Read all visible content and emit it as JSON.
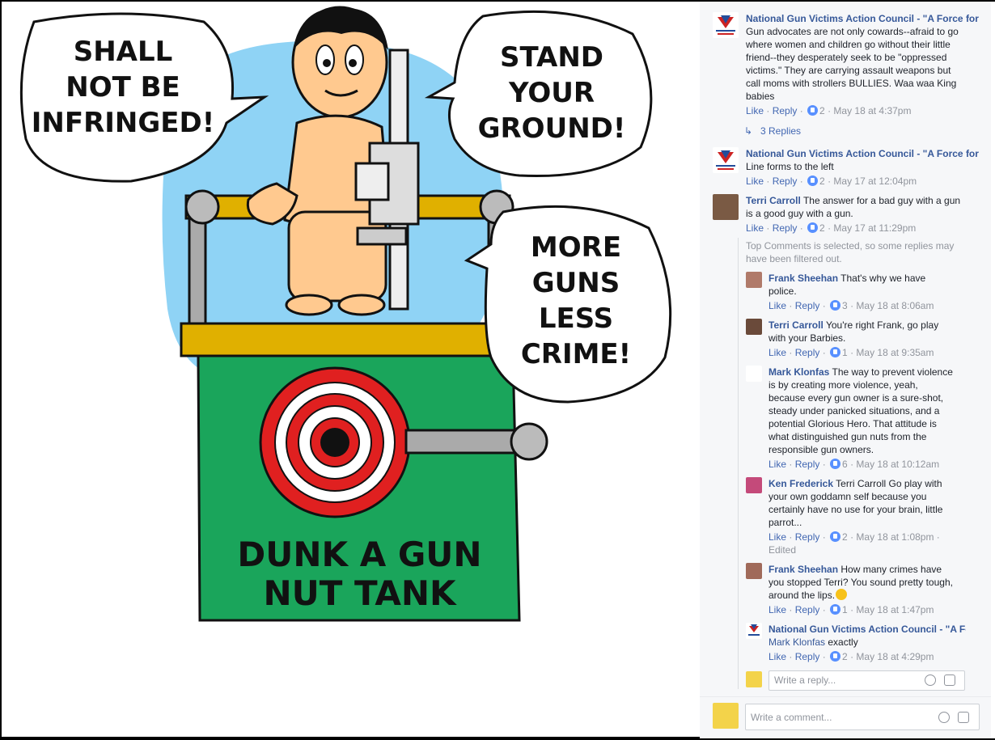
{
  "cartoon": {
    "bubble1": [
      "SHALL",
      "NOT BE",
      "INFRINGED!"
    ],
    "bubble2": [
      "STAND",
      "YOUR",
      "GROUND!"
    ],
    "bubble3": [
      "MORE",
      "GUNS",
      "LESS",
      "CRIME!"
    ],
    "tank": [
      "DUNK A GUN",
      "NUT TANK"
    ]
  },
  "comments": [
    {
      "author": "National Gun Victims Action Council - \"A Force for",
      "text_lines": [
        "Gun advocates are not only cowards--afraid to go",
        "where women and children go without their little",
        "friend--they desperately seek to be \"oppressed",
        "victims.\" They are carrying assault weapons but",
        "call moms with strollers BULLIES. Waa waa King",
        "babies"
      ],
      "likes": "2",
      "time": "May 18 at 4:37pm"
    },
    {
      "author": "National Gun Victims Action Council - \"A Force for",
      "text_lines": [
        "Line forms to the left"
      ],
      "likes": "2",
      "time": "May 17 at 12:04pm"
    },
    {
      "author": "Terri Carroll",
      "text_lines": [
        "The answer for a bad guy with a gun",
        "is a good guy with a gun."
      ],
      "likes": "2",
      "time": "May 17 at 11:29pm"
    }
  ],
  "replies_link": "3 Replies",
  "filter_note": [
    "Top Comments is selected, so some replies may",
    "have been filtered out."
  ],
  "replies": [
    {
      "author": "Frank Sheehan",
      "text_lines": [
        "That's why we have",
        "police."
      ],
      "likes": "3",
      "time": "May 18 at 8:06am"
    },
    {
      "author": "Terri Carroll",
      "text_lines": [
        "You're right Frank, go play",
        "with your Barbies."
      ],
      "likes": "1",
      "time": "May 18 at 9:35am"
    },
    {
      "author": "Mark Klonfas",
      "text_lines": [
        "The way to prevent violence",
        "is by creating more violence, yeah,",
        "because every gun owner is a sure-shot,",
        "steady under panicked situations, and a",
        "potential Glorious Hero. That attitude is",
        "what distinguished gun nuts from the",
        "responsible gun owners."
      ],
      "likes": "6",
      "time": "May 18 at 10:12am"
    },
    {
      "author": "Ken Frederick",
      "text_lines": [
        "Terri Carroll Go play with",
        "your own goddamn self because you",
        "certainly have no use for your brain, little",
        "parrot..."
      ],
      "likes": "2",
      "time": "May 18 at 1:08pm",
      "edited": "Edited"
    },
    {
      "author": "Frank Sheehan",
      "text_lines": [
        "How many crimes have",
        "you stopped Terri? You sound pretty tough,",
        "around the lips."
      ],
      "likes": "1",
      "time": "May 18 at 1:47pm"
    },
    {
      "author": "National Gun Victims Action Council - \"A Fc",
      "mention": "Mark Klonfas",
      "text_lines": [
        "exactly"
      ],
      "likes": "2",
      "time": "May 18 at 4:29pm"
    }
  ],
  "actions": {
    "like": "Like",
    "reply": "Reply",
    "sep": " · "
  },
  "reply_placeholder": "Write a reply...",
  "comment_placeholder": "Write a comment...",
  "colors": {
    "link": "#365899",
    "muted": "#90949c",
    "like_blue": "#5890ff",
    "tank_green": "#1aa55b",
    "sky": "#8fd3f5"
  }
}
